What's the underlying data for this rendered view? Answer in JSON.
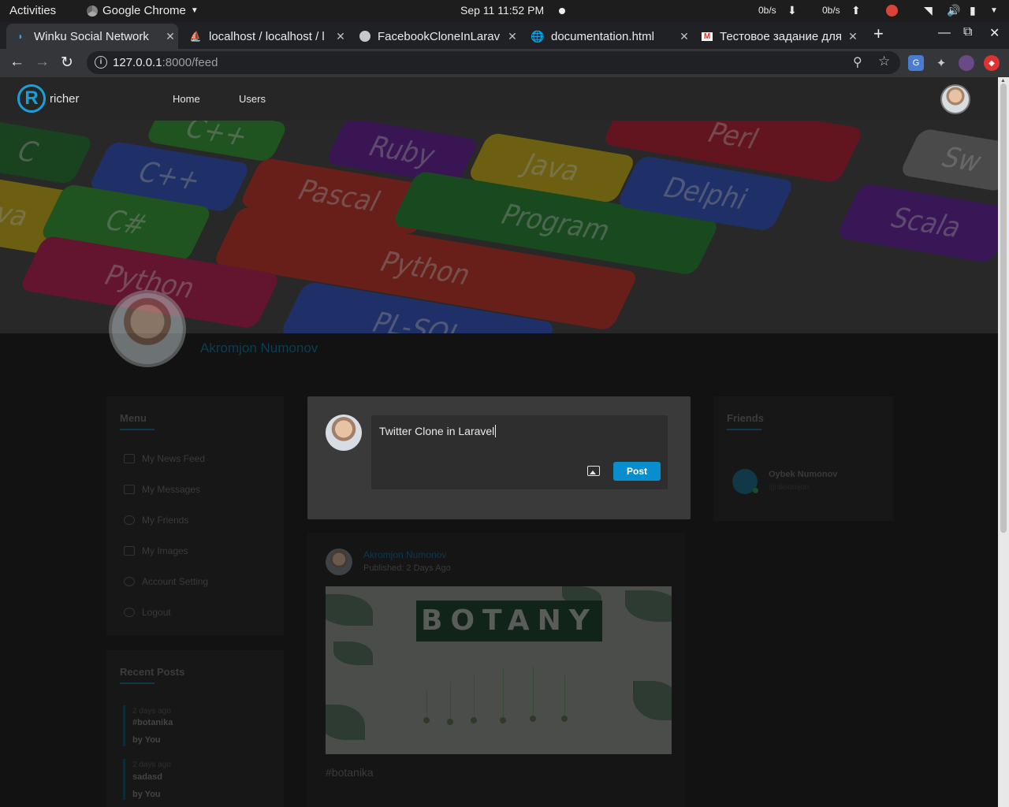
{
  "os": {
    "activities": "Activities",
    "app_name": "Google Chrome",
    "clock": "Sep 11  11:52 PM",
    "net_down": "0b/s",
    "net_up": "0b/s"
  },
  "browser": {
    "tabs": [
      {
        "title": "Winku Social Network",
        "icon": "winku-icon"
      },
      {
        "title": "localhost / localhost / l",
        "icon": "phpmyadmin-icon"
      },
      {
        "title": "FacebookCloneInLarav",
        "icon": "github-icon"
      },
      {
        "title": "documentation.html",
        "icon": "globe-icon"
      },
      {
        "title": "Тестовое задание для",
        "icon": "gmail-icon"
      }
    ],
    "url_host": "127.0.0.1",
    "url_path": ":8000/feed"
  },
  "site": {
    "logo_text": "richer",
    "nav": [
      "Home",
      "Users"
    ],
    "profile_name": "Akromjon Numonov",
    "cover_keys": [
      "C",
      "C++",
      "Ruby",
      "Java",
      "Perl",
      "Sw",
      "C++",
      "Pascal",
      "Program",
      "Delphi",
      "Scala",
      "va",
      "C#",
      "Python",
      "Python",
      "PL-SQL"
    ]
  },
  "menu": {
    "heading": "Menu",
    "items": [
      "My News Feed",
      "My Messages",
      "My Friends",
      "My Images",
      "Account Setting",
      "Logout"
    ]
  },
  "recent_posts": {
    "heading": "Recent Posts",
    "items": [
      {
        "date": "2 days ago",
        "title": "#botanika",
        "by": "by You"
      },
      {
        "date": "2 days ago",
        "title": "sadasd",
        "by": "by You"
      }
    ]
  },
  "composer": {
    "text": "Twitter Clone in Laravel",
    "post_label": "Post"
  },
  "post": {
    "author": "Akromjon Numonov",
    "published": "Published: 2 Days Ago",
    "image_banner": "BOTANY",
    "caption": "#botanika"
  },
  "friends": {
    "heading": "Friends",
    "items": [
      {
        "name": "Oybek Numonov",
        "handle": "@akromjon"
      }
    ]
  },
  "colors": {
    "accent": "#088dcd",
    "logo": "#1aa0d8"
  }
}
